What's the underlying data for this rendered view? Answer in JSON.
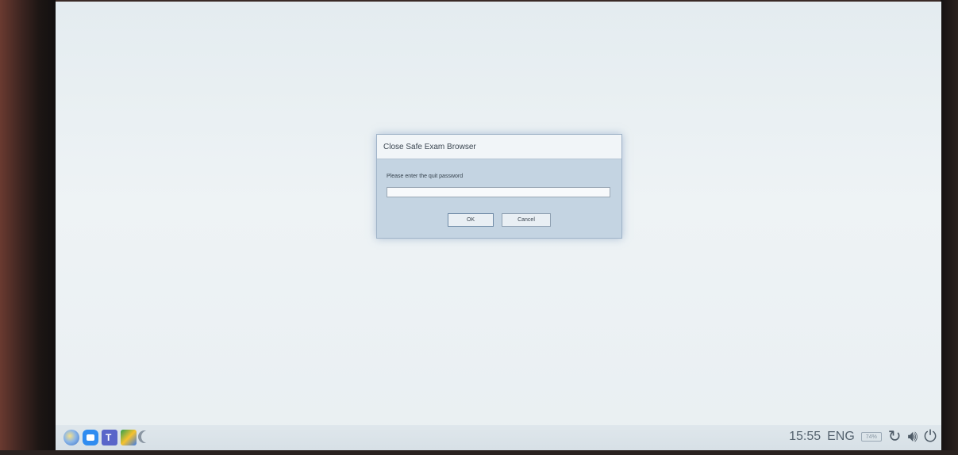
{
  "dialog": {
    "title": "Close Safe Exam Browser",
    "prompt": "Please enter the quit password",
    "password_value": "",
    "ok_label": "OK",
    "cancel_label": "Cancel"
  },
  "taskbar": {
    "apps": [
      {
        "name": "safe-exam-browser",
        "icon": "seb-icon"
      },
      {
        "name": "zoom",
        "icon": "zoom-icon"
      },
      {
        "name": "microsoft-teams",
        "icon": "teams-icon"
      },
      {
        "name": "google-meet",
        "icon": "meet-icon"
      },
      {
        "name": "night-mode",
        "icon": "moon-icon"
      }
    ],
    "clock": "15:55",
    "language": "ENG",
    "battery_label": "74%",
    "tray_icons": [
      "reload-icon",
      "volume-icon",
      "power-icon"
    ]
  },
  "colors": {
    "screen_bg": "#e9eff2",
    "dialog_bg": "#c4d4e2",
    "taskbar_bg": "#dde5ea",
    "taskbar_text": "#55636f"
  }
}
